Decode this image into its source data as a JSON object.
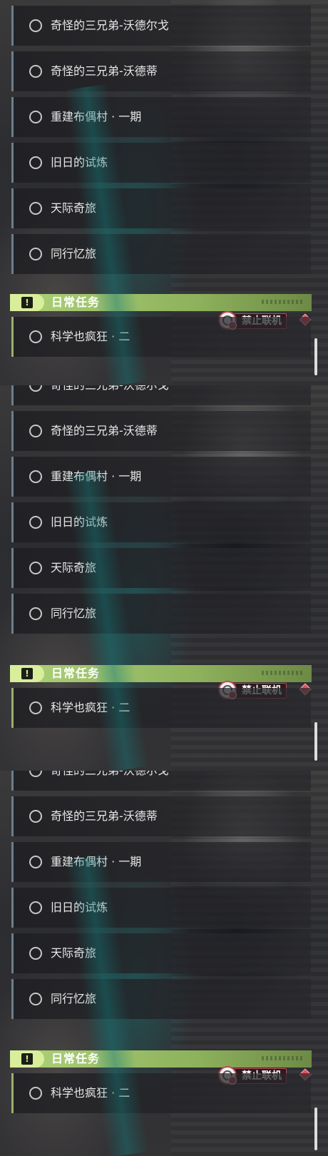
{
  "quest_tracker": {
    "tasks": [
      {
        "label": "奇怪的三兄弟-沃德尔戈"
      },
      {
        "label": "奇怪的三兄弟-沃德蒂"
      },
      {
        "label": "重建布偶村 · 一期"
      },
      {
        "label": "旧日的试炼"
      },
      {
        "label": "天际奇旅"
      },
      {
        "label": "同行忆旅"
      }
    ],
    "daily_header": {
      "title": "日常任务",
      "icon": "exclamation-icon"
    },
    "daily_task": {
      "label": "科学也疯狂 · 二"
    },
    "coop_badge": {
      "text": "禁止联机",
      "icon": "globe-no-coop-icon"
    },
    "colors": {
      "task_accent": "#6b7f8c",
      "daily_accent": "#aed27a",
      "coop_accent": "#c24a55"
    }
  }
}
